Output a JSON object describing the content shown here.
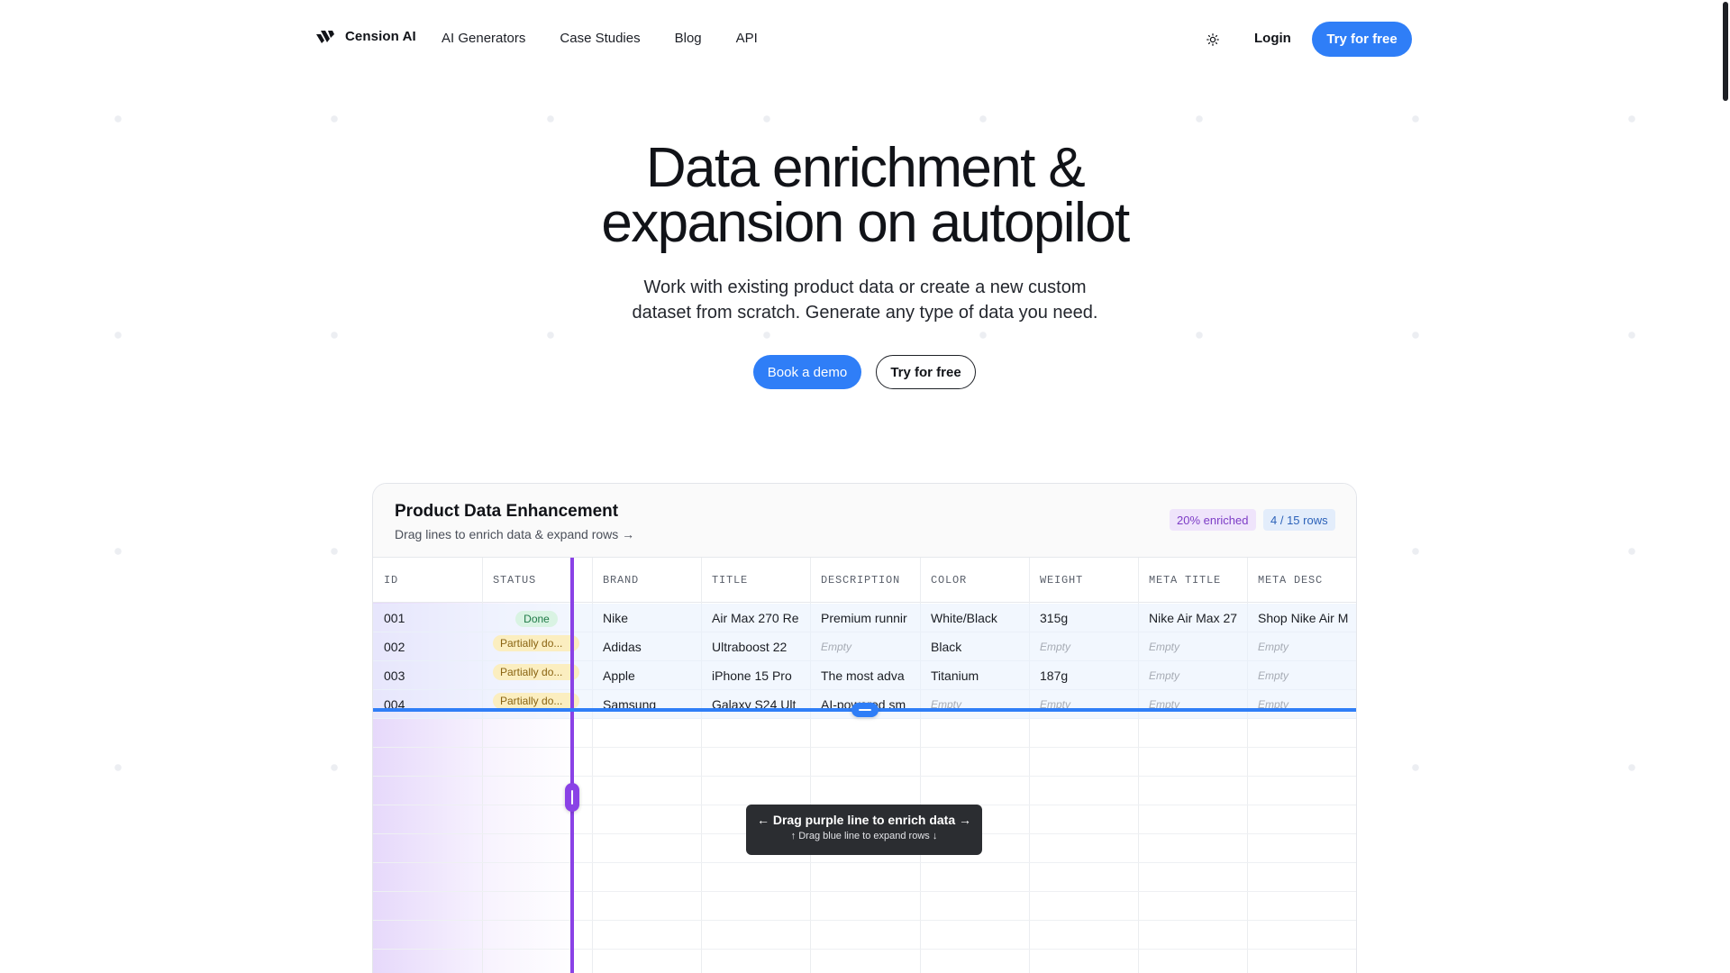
{
  "nav": {
    "brand": "Cension AI",
    "links": [
      "AI Generators",
      "Case Studies",
      "Blog",
      "API"
    ],
    "theme_icon": "sun-icon",
    "login": "Login",
    "cta": "Try for free"
  },
  "hero": {
    "title_line1": "Data enrichment &",
    "title_line2": "expansion on autopilot",
    "subtitle_line1": "Work with existing product data or create a new custom",
    "subtitle_line2": "dataset from scratch. Generate any type of data you need.",
    "btn_demo": "Book a demo",
    "btn_try": "Try for free"
  },
  "colors": {
    "accent_blue": "#2f7ef7",
    "accent_purple": "#8a42e6"
  },
  "card": {
    "title": "Product Data Enhancement",
    "hint": "Drag lines to enrich data & expand rows →",
    "badge_enriched": "20% enriched",
    "badge_rows": "4 / 15 rows",
    "columns": [
      "ID",
      "STATUS",
      "BRAND",
      "TITLE",
      "DESCRIPTION",
      "COLOR",
      "WEIGHT",
      "META TITLE",
      "META DESC"
    ],
    "rows": [
      {
        "id": "001",
        "status": "Done",
        "brand": "Nike",
        "title": "Air Max 270 Re",
        "description": "Premium runnir",
        "color": "White/Black",
        "weight": "315g",
        "meta_title": "Nike Air Max 27",
        "meta_desc": "Shop Nike Air M"
      },
      {
        "id": "002",
        "status": "Partially do...",
        "brand": "Adidas",
        "title": "Ultraboost 22",
        "description": "Empty",
        "color": "Black",
        "weight": "Empty",
        "meta_title": "Empty",
        "meta_desc": "Empty"
      },
      {
        "id": "003",
        "status": "Partially do...",
        "brand": "Apple",
        "title": "iPhone 15 Pro",
        "description": "The most adva",
        "color": "Titanium",
        "weight": "187g",
        "meta_title": "Empty",
        "meta_desc": "Empty"
      },
      {
        "id": "004",
        "status": "Partially do...",
        "brand": "Samsung",
        "title": "Galaxy S24 Ult",
        "description": "AI-powered sm",
        "color": "Empty",
        "weight": "Empty",
        "meta_title": "Empty",
        "meta_desc": "Empty"
      }
    ],
    "tooltip_line1": "← Drag purple line to enrich data →",
    "tooltip_line2": "↑ Drag blue line to expand rows ↓"
  }
}
